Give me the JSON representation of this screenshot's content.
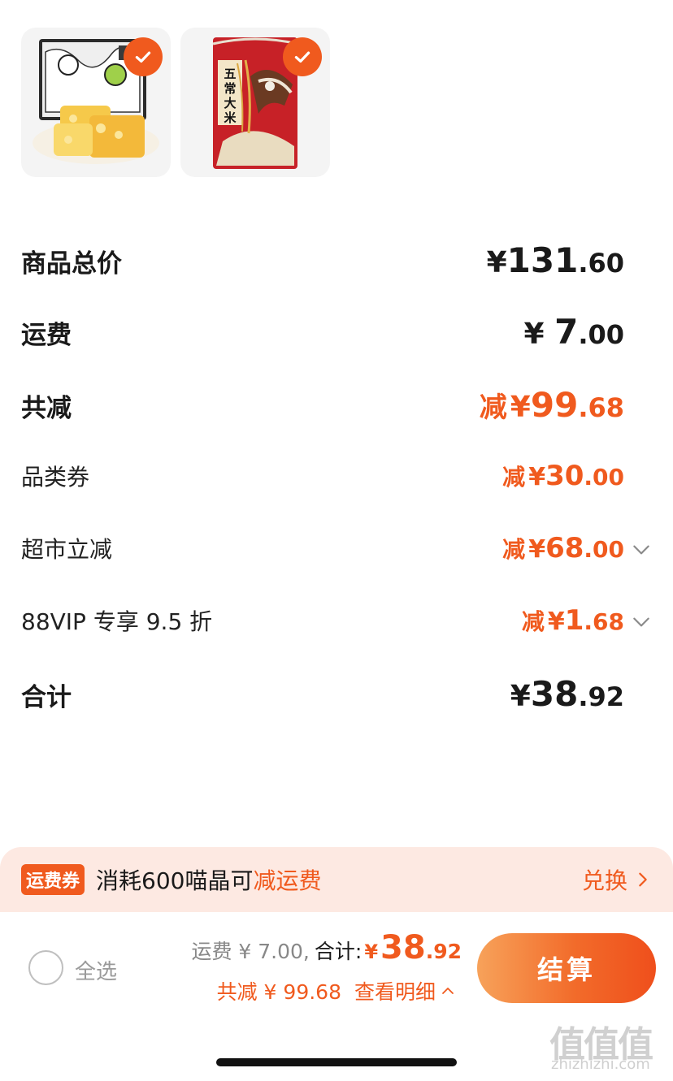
{
  "products": [
    {
      "name": "product-cheese-cake-box",
      "selected": true
    },
    {
      "name": "product-wuchang-rice-bag",
      "package_text": "五常大米",
      "selected": true
    }
  ],
  "rows": {
    "goods_total": {
      "label": "商品总价",
      "cur": "¥",
      "int": "131",
      "dec": ".60"
    },
    "shipping": {
      "label": "运费",
      "cur": "¥ ",
      "int": "7",
      "dec": ".00"
    },
    "total_reduce": {
      "label": "共减",
      "prefix": "减",
      "cur": "¥",
      "int": "99",
      "dec": ".68"
    },
    "category_coupon": {
      "label": "品类券",
      "prefix": "减",
      "cur": "¥",
      "int": "30",
      "dec": ".00"
    },
    "supermarket_off": {
      "label": "超市立减",
      "prefix": "减",
      "cur": "¥",
      "int": "68",
      "dec": ".00"
    },
    "vip_discount": {
      "label": "88VIP 专享 9.5 折",
      "prefix": "减",
      "cur": "¥",
      "int": "1",
      "dec": ".68"
    },
    "sum": {
      "label": "合计",
      "cur": "¥",
      "int": "38",
      "dec": ".92"
    }
  },
  "banner": {
    "tag": "运费券",
    "text_prefix": "消耗600喵晶可",
    "text_highlight": "减运费",
    "action": "兑换"
  },
  "bottom": {
    "select_all": "全选",
    "shipping_note": "运费 ¥ 7.00,",
    "total_label": "合计:",
    "total_cur": "¥",
    "total_int": "38",
    "total_dec": ".92",
    "save_note": "共减 ¥ 99.68",
    "detail_link": "查看明细",
    "checkout": "结算"
  },
  "watermark": {
    "logo": "值值值",
    "url": "zhizhizhi.com"
  },
  "colors": {
    "accent": "#f05a1e",
    "banner_bg": "#fde9e2"
  }
}
